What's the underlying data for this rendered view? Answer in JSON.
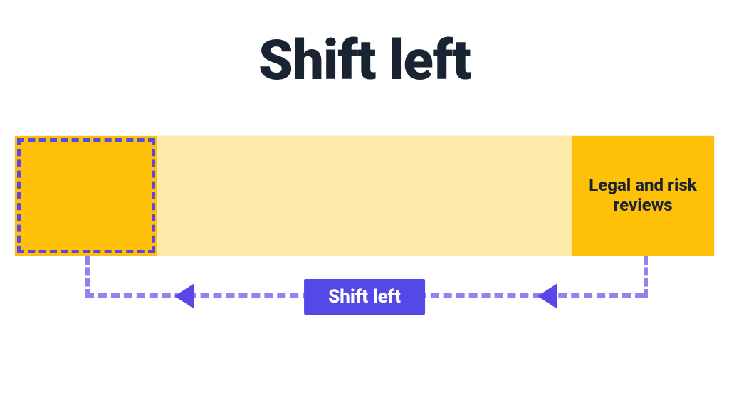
{
  "title": "Shift left",
  "bar": {
    "right_label": "Legal and risk reviews"
  },
  "connector": {
    "pill_label": "Shift left"
  },
  "colors": {
    "accent_purple": "#5448e6",
    "accent_purple_light": "#8f84ee",
    "bar_yellow": "#ffc107",
    "bar_yellow_light": "#ffe9a8",
    "text_dark": "#1a2332"
  }
}
